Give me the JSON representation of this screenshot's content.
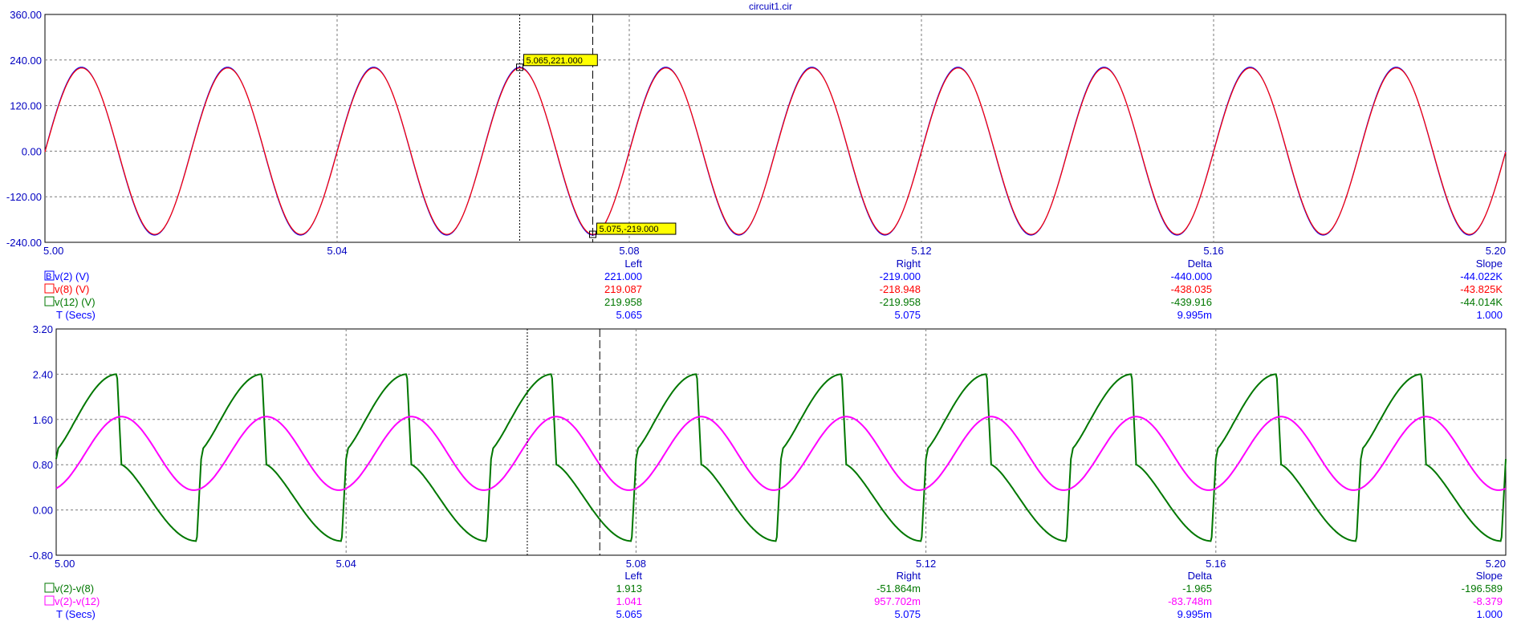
{
  "window": {
    "title": "circuit1.cir"
  },
  "colors": {
    "axis_text": "#0000c0",
    "blue": "#0000ff",
    "red": "#ff0000",
    "green": "#007700",
    "magenta": "#ff00ff",
    "grid": "#7a7a7a",
    "annotation_bg": "#ffff00"
  },
  "cursors": {
    "left_x": 5.065,
    "right_x": 5.075
  },
  "chart_data": [
    {
      "type": "line",
      "xlim": [
        5.0,
        5.2
      ],
      "ylim": [
        -240,
        360
      ],
      "xticks": [
        "5.00",
        "5.04",
        "5.08",
        "5.12",
        "5.16",
        "5.20"
      ],
      "yticks": [
        "360.00",
        "240.00",
        "120.00",
        "0.00",
        "-120.00",
        "-240.00"
      ],
      "grid": true,
      "series": [
        {
          "name": "v(2) (V)",
          "color": "#0000ff",
          "waveform": "sine",
          "amplitude": 221,
          "frequency_hz": 50,
          "phase_deg": 0
        },
        {
          "name": "v(8) (V)",
          "color": "#ff0000",
          "waveform": "sine",
          "amplitude": 219.1,
          "frequency_hz": 50,
          "phase_deg": -0.5
        }
      ],
      "annotations": [
        {
          "label": "5.065,221.000",
          "x": 5.065,
          "y": 221.0
        },
        {
          "label": "5.075,-219.000",
          "x": 5.075,
          "y": -219.0
        }
      ]
    },
    {
      "type": "line",
      "xlim": [
        5.0,
        5.2
      ],
      "ylim": [
        -0.8,
        3.2
      ],
      "xticks": [
        "5.00",
        "5.04",
        "5.08",
        "5.12",
        "5.16",
        "5.20"
      ],
      "yticks": [
        "3.20",
        "2.40",
        "1.60",
        "0.80",
        "0.00",
        "-0.80"
      ],
      "grid": true,
      "series": [
        {
          "name": "v(2)-v(8)",
          "color": "#007700",
          "waveform": "rectified-spike",
          "min": -0.55,
          "max": 2.4,
          "period": 0.02
        },
        {
          "name": "v(2)-v(12)",
          "color": "#ff00ff",
          "waveform": "sine",
          "amplitude": 0.65,
          "offset": 1.0,
          "period": 0.02
        }
      ]
    }
  ],
  "table1": {
    "headers": [
      "Left",
      "Right",
      "Delta",
      "Slope"
    ],
    "rows": [
      {
        "label": "v(2) (V)",
        "marker": "B",
        "color": "#0000ff",
        "values": [
          "221.000",
          "-219.000",
          "-440.000",
          "-44.022K"
        ]
      },
      {
        "label": "v(8) (V)",
        "marker": "",
        "color": "#ff0000",
        "values": [
          "219.087",
          "-218.948",
          "-438.035",
          "-43.825K"
        ]
      },
      {
        "label": "v(12) (V)",
        "marker": "",
        "color": "#007700",
        "values": [
          "219.958",
          "-219.958",
          "-439.916",
          "-44.014K"
        ]
      },
      {
        "label": "T (Secs)",
        "marker": null,
        "color": "#0000ff",
        "values": [
          "5.065",
          "5.075",
          "9.995m",
          "1.000"
        ]
      }
    ]
  },
  "table2": {
    "headers": [
      "Left",
      "Right",
      "Delta",
      "Slope"
    ],
    "rows": [
      {
        "label": "v(2)-v(8)",
        "marker": "",
        "color": "#007700",
        "values": [
          "1.913",
          "-51.864m",
          "-1.965",
          "-196.589"
        ]
      },
      {
        "label": "v(2)-v(12)",
        "marker": "",
        "color": "#ff00ff",
        "values": [
          "1.041",
          "957.702m",
          "-83.748m",
          "-8.379"
        ]
      },
      {
        "label": "T (Secs)",
        "marker": null,
        "color": "#0000ff",
        "values": [
          "5.065",
          "5.075",
          "9.995m",
          "1.000"
        ]
      }
    ]
  }
}
